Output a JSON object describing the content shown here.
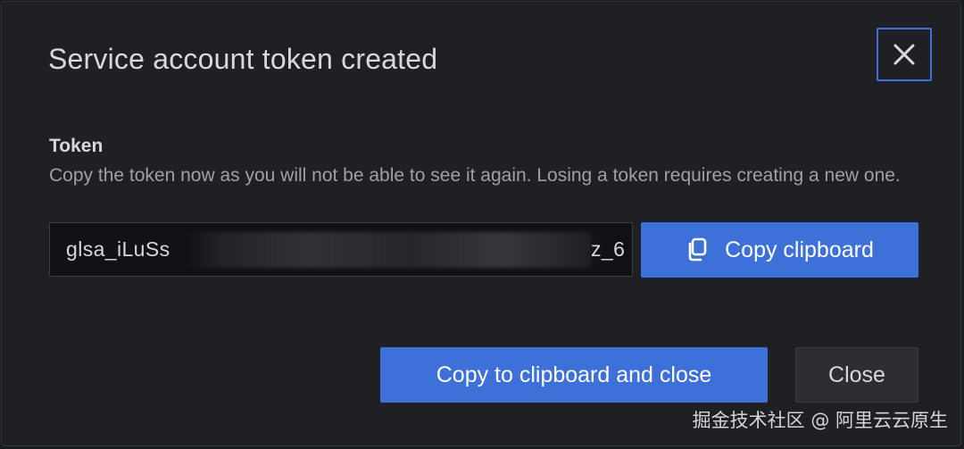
{
  "modal": {
    "title": "Service account token created",
    "close_icon": "close-icon"
  },
  "token_field": {
    "label": "Token",
    "description": "Copy the token now as you will not be able to see it again. Losing a token requires creating a new one.",
    "value_visible_start": "glsa_iLuSs",
    "value_visible_end": "z_6"
  },
  "buttons": {
    "copy_clipboard": "Copy clipboard",
    "copy_icon": "copy-icon",
    "copy_and_close": "Copy to clipboard and close",
    "close": "Close"
  },
  "watermark": "掘金技术社区 @ 阿里云云原生",
  "colors": {
    "accent": "#3d71d9",
    "background": "#1f2024",
    "input_bg": "#111217"
  }
}
